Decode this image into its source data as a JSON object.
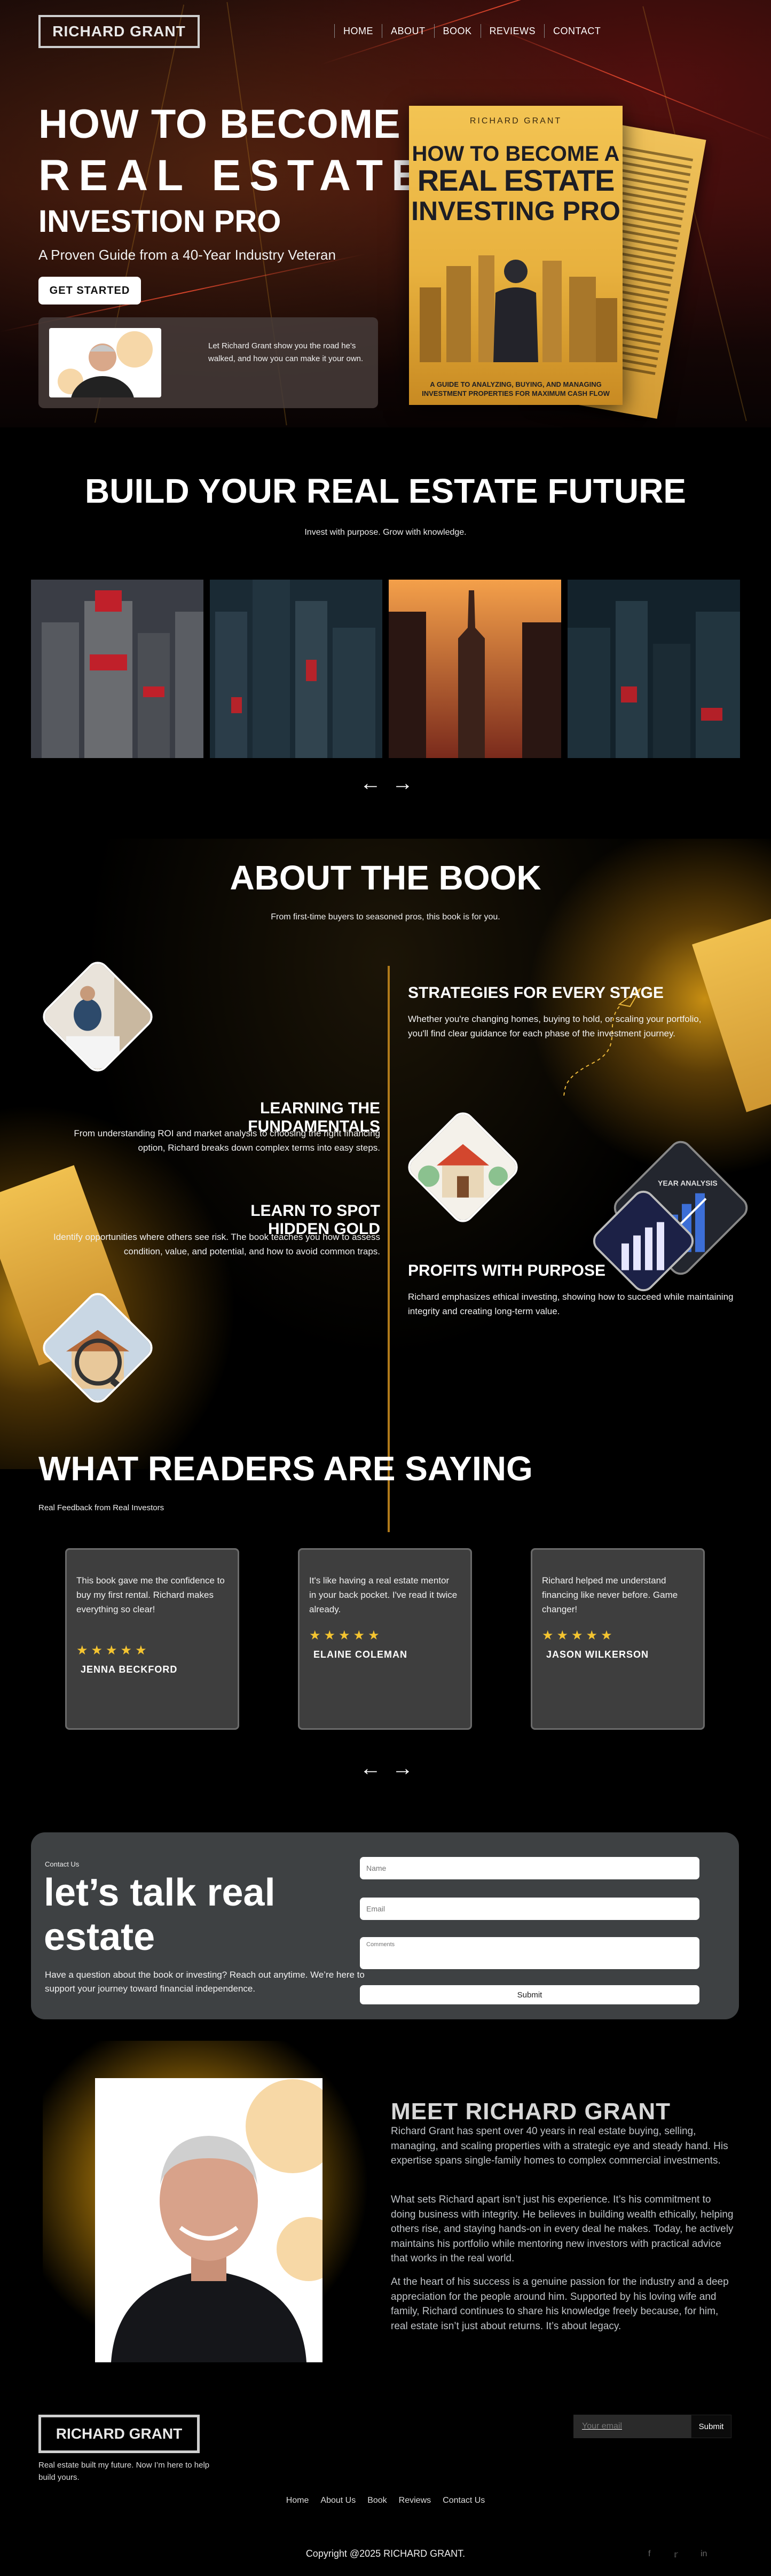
{
  "brand": "RICHARD GRANT",
  "nav": [
    "HOME",
    "ABOUT",
    "BOOK",
    "REVIEWS",
    "CONTACT"
  ],
  "hero": {
    "title_line1": "HOW TO BECOME A",
    "title_line2": "REAL ESTATE",
    "title_line3": "INVESTION PRO",
    "subtitle": "A Proven Guide from a 40-Year Industry Veteran",
    "cta": "GET STARTED",
    "card_text": "Let Richard Grant show you the road he's walked, and how you can make it your own."
  },
  "book_cover": {
    "author": "RICHARD GRANT",
    "title_a": "HOW TO BECOME A",
    "title_b": "REAL ESTATE",
    "title_c": "INVESTING PRO",
    "footer": "A GUIDE TO ANALYZING, BUYING, AND MANAGING INVESTMENT PROPERTIES FOR MAXIMUM CASH FLOW"
  },
  "build": {
    "title": "BUILD YOUR REAL ESTATE FUTURE",
    "subtitle": "Invest with purpose. Grow with knowledge."
  },
  "about": {
    "title": "ABOUT THE BOOK",
    "subtitle": "From first-time buyers to seasoned pros, this book is for you.",
    "features": [
      {
        "title": "STRATEGIES FOR EVERY STAGE",
        "text": "Whether you're changing homes, buying to hold, or scaling your portfolio, you'll find clear guidance for each phase of the investment journey."
      },
      {
        "title": "LEARNING THE FUNDAMENTALS",
        "text": "From understanding ROI and market analysis to choosing the right financing option, Richard breaks down complex terms into easy steps."
      },
      {
        "title": "LEARN TO SPOT HIDDEN GOLD",
        "text": "Identify opportunities where others see risk. The book teaches you how to assess condition, value, and potential, and how to avoid common traps."
      },
      {
        "title": "PROFITS WITH PURPOSE",
        "text": "Richard emphasizes ethical investing, showing how to succeed while maintaining integrity and creating long-term value."
      }
    ],
    "chart_label": "YEAR ANALYSIS"
  },
  "reviews": {
    "title": "WHAT READERS ARE SAYING",
    "subtitle": "Real Feedback from Real Investors",
    "items": [
      {
        "quote": "This book gave me the confidence to buy my first rental. Richard makes everything so clear!",
        "stars": "★★★★★",
        "name": "JENNA BECKFORD"
      },
      {
        "quote": "It's like having a real estate mentor in your back pocket. I've read it twice already.",
        "stars": "★★★★★",
        "name": "ELAINE COLEMAN"
      },
      {
        "quote": "Richard helped me understand financing like never before. Game changer!",
        "stars": "★★★★★",
        "name": "JASON WILKERSON"
      }
    ]
  },
  "contact": {
    "eyebrow": "Contact Us",
    "heading_line1": "let’s talk real",
    "heading_line2": "estate",
    "description": "Have a question about the book or investing? Reach out anytime. We’re here to support your journey toward financial independence.",
    "name_placeholder": "Name",
    "email_placeholder": "Email",
    "comments_placeholder": "Comments",
    "submit": "Submit"
  },
  "meet": {
    "title": "MEET RICHARD GRANT",
    "p1": "Richard Grant has spent over 40 years in real estate buying, selling, managing, and scaling properties with a strategic eye and steady hand. His expertise spans single-family homes to complex commercial investments.",
    "p2": "What sets Richard apart isn’t just his experience. It’s his commitment to doing business with integrity. He believes in building wealth ethically, helping others rise, and staying hands-on in every deal he makes. Today, he actively maintains his portfolio while mentoring new investors with practical advice that works in the real world.",
    "p3": "At the heart of his success is a genuine passion for the industry and a deep appreciation for the people around him. Supported by his loving wife and family, Richard continues to share his knowledge freely because, for him, real estate isn’t just about returns. It’s about legacy."
  },
  "footer": {
    "tagline": "Real estate built my future. Now I’m here to help build yours.",
    "email_placeholder": "Your email",
    "subscribe": "Submit",
    "links": [
      "Home",
      "About Us",
      "Book",
      "Reviews",
      "Contact Us"
    ],
    "copyright": "Copyright @2025 RICHARD GRANT.",
    "social_icons": [
      "facebook-icon",
      "twitter-icon",
      "linkedin-icon"
    ]
  },
  "colors": {
    "accent_gold": "#f4c430",
    "divider_gold": "#b07a1a",
    "card_gray": "#3e3e3e"
  }
}
